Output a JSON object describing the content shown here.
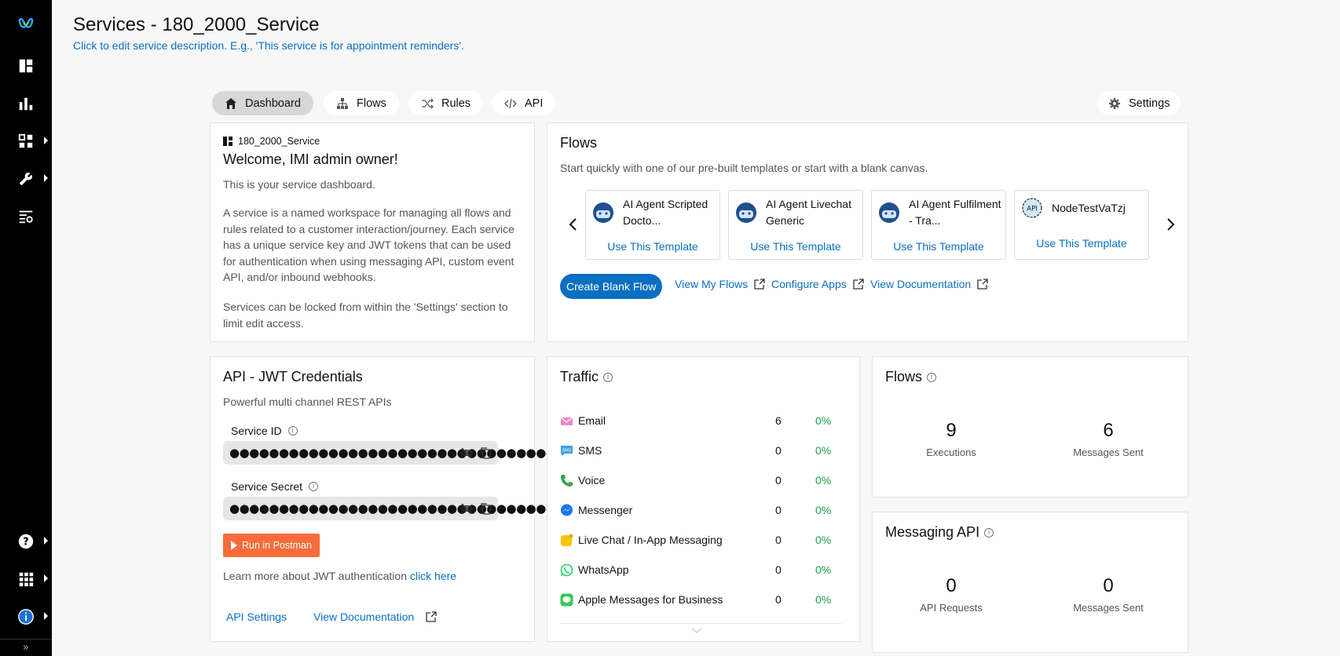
{
  "header": {
    "title": "Services - 180_2000_Service",
    "description": "Click to edit service description. E.g., 'This service is for appointment reminders'."
  },
  "tabs": [
    {
      "label": "Dashboard",
      "icon": "home-icon",
      "active": true
    },
    {
      "label": "Flows",
      "icon": "flows-icon"
    },
    {
      "label": "Rules",
      "icon": "shuffle-icon"
    },
    {
      "label": "API",
      "icon": "code-icon"
    }
  ],
  "settings_label": "Settings",
  "welcome": {
    "service_name": "180_2000_Service",
    "title": "Welcome, IMI admin owner!",
    "p1": "This is your service dashboard.",
    "p2": "A service is a named workspace for managing all flows and rules related to a customer interaction/journey. Each service has a unique service key and JWT tokens that can be used for authentication when using messaging API, custom event API, and/or inbound webhooks.",
    "p3": "Services can be locked from within the 'Settings' section to limit edit access."
  },
  "flows_card": {
    "title": "Flows",
    "subtitle": "Start quickly with one of our pre-built templates or start with a blank canvas.",
    "templates": [
      {
        "name": "AI Agent Scripted Docto...",
        "action": "Use This Template",
        "icon": "ai-agent-avatar-icon"
      },
      {
        "name": "AI Agent Livechat Generic",
        "action": "Use This Template",
        "icon": "ai-agent-avatar-icon"
      },
      {
        "name": "AI Agent Fulfilment - Tra...",
        "action": "Use This Template",
        "icon": "ai-agent-avatar-icon"
      },
      {
        "name": "NodeTestVaTzj",
        "action": "Use This Template",
        "icon": "api-gear-icon"
      }
    ],
    "create_label": "Create Blank Flow",
    "links": [
      "View My Flows",
      "Configure Apps",
      "View Documentation"
    ]
  },
  "jwt": {
    "title": "API - JWT Credentials",
    "subtitle": "Powerful multi channel REST APIs",
    "service_id_label": "Service ID",
    "service_id_value": "●●●●●●●●●●●●●●●●●●●●●●●●●●●●●●●●●●●  ...",
    "service_secret_label": "Service Secret",
    "service_secret_value": "●●●●●●●●●●●●●●●●●●●●●●●●●●●●●●●●●●●  ...",
    "postman_label": "Run in Postman",
    "learn_text": "Learn more about JWT authentication",
    "learn_link": "click here",
    "api_settings": "API Settings",
    "view_docs": "View Documentation"
  },
  "traffic": {
    "title": "Traffic",
    "rows": [
      {
        "label": "Email",
        "count": "6",
        "pct": "0%",
        "icon": "email-icon",
        "color": "#e98bc2"
      },
      {
        "label": "SMS",
        "count": "0",
        "pct": "0%",
        "icon": "sms-icon",
        "color": "#3aa0e8"
      },
      {
        "label": "Voice",
        "count": "0",
        "pct": "0%",
        "icon": "phone-icon",
        "color": "#37a24b"
      },
      {
        "label": "Messenger",
        "count": "0",
        "pct": "0%",
        "icon": "messenger-icon",
        "color": "#1877f2"
      },
      {
        "label": "Live Chat / In-App Messaging",
        "count": "0",
        "pct": "0%",
        "icon": "livechat-icon",
        "color": "#f7c600"
      },
      {
        "label": "WhatsApp",
        "count": "0",
        "pct": "0%",
        "icon": "whatsapp-icon",
        "color": "#25d366"
      },
      {
        "label": "Apple Messages for Business",
        "count": "0",
        "pct": "0%",
        "icon": "apple-messages-icon",
        "color": "#34c759"
      }
    ]
  },
  "flows_stats": {
    "title": "Flows",
    "executions": "9",
    "executions_label": "Executions",
    "messages": "6",
    "messages_label": "Messages Sent"
  },
  "messaging_api": {
    "title": "Messaging API",
    "requests": "0",
    "requests_label": "API Requests",
    "messages": "0",
    "messages_label": "Messages Sent"
  },
  "colors": {
    "accent": "#0a6fc2",
    "postman": "#f76c3a",
    "success": "#1aa34a",
    "sidebar": "#000000"
  }
}
